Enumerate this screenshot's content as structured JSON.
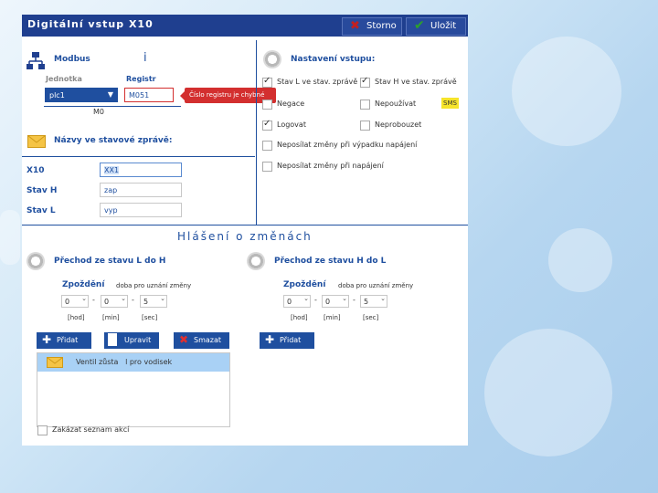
{
  "window": {
    "title": "Digitální vstup X10",
    "cancel_label": "Storno",
    "save_label": "Uložit"
  },
  "modbus": {
    "heading": "Modbus",
    "info_mark": "i",
    "unit_label": "Jednotka",
    "register_label": "Registr",
    "unit_value": "plc1",
    "register_value": "M051",
    "error_tooltip": "Číslo registru je chybné",
    "sub_value": "M0"
  },
  "names": {
    "heading": "Názvy ve stavové zprávě:",
    "rows": [
      {
        "label": "X10",
        "value": "XX1"
      },
      {
        "label": "Stav H",
        "value": "zap"
      },
      {
        "label": "Stav L",
        "value": "vyp"
      }
    ]
  },
  "input_settings": {
    "heading": "Nastavení vstupu:",
    "options": [
      {
        "label": "Stav L ve stav. zprávě",
        "checked": true
      },
      {
        "label": "Stav H ve stav. zprávě",
        "checked": true
      },
      {
        "label": "Negace",
        "checked": false
      },
      {
        "label": "Nepoužívat",
        "checked": false
      },
      {
        "label": "Logovat",
        "checked": true
      },
      {
        "label": "Neprobouzet",
        "checked": false
      },
      {
        "label": "Neposílat změny při výpadku napájení",
        "checked": false
      },
      {
        "label": "Neposílat změny při napájení",
        "checked": false
      }
    ],
    "sms_badge": "SMS"
  },
  "reports": {
    "heading": "Hlášení o změnách",
    "left": {
      "title": "Přechod ze stavu L do H",
      "delay_label": "Zpoždění",
      "delay_note": "doba pro uznání změny",
      "hod": "0",
      "min": "0",
      "sec": "5",
      "unit_hod": "[hod]",
      "unit_min": "[min]",
      "unit_sec": "[sec]"
    },
    "right": {
      "title": "Přechod ze stavu H do L",
      "delay_label": "Zpoždění",
      "delay_note": "doba pro uznání změny",
      "hod": "0",
      "min": "0",
      "sec": "5",
      "unit_hod": "[hod]",
      "unit_min": "[min]",
      "unit_sec": "[sec]"
    },
    "add_label": "Přidat",
    "edit_label": "Upravit",
    "delete_label": "Smazat",
    "add_right_label": "Přidat",
    "list_item": "Ventil zůsta   l pro vodisek",
    "hide_list_label": "Zakázat seznam akcí"
  },
  "colors": {
    "accent": "#1f4f9f",
    "titlebar": "#1f3f8f",
    "error": "#d32f2f"
  }
}
